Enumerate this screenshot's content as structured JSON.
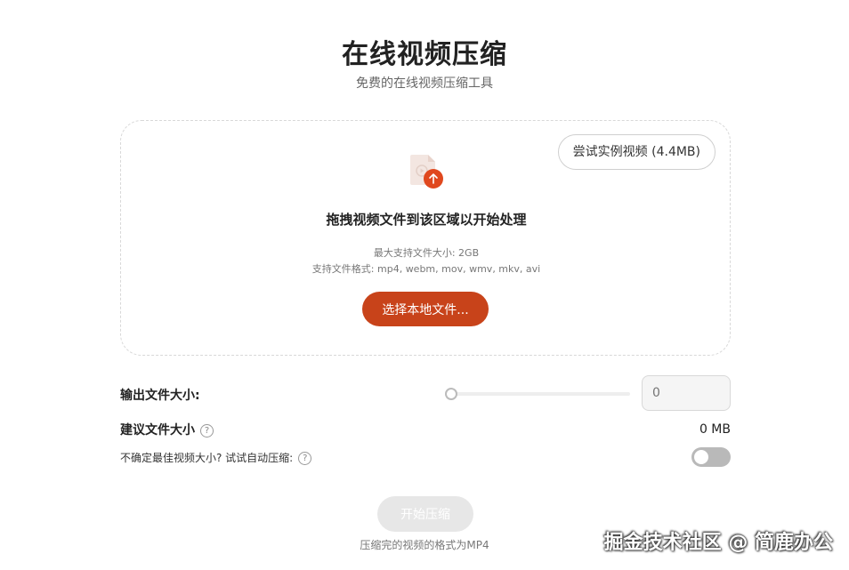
{
  "header": {
    "title": "在线视频压缩",
    "subtitle": "免费的在线视频压缩工具"
  },
  "dropzone": {
    "sample_button": "尝试实例视频 (4.4MB)",
    "icon": "video-file-upload-icon",
    "title": "拖拽视频文件到该区域以开始处理",
    "max_size": "最大支持文件大小: 2GB",
    "formats": "支持文件格式: mp4, webm, mov, wmv, mkv, avi",
    "choose_button": "选择本地文件..."
  },
  "output": {
    "label": "输出文件大小:",
    "slider_value": 0,
    "input_placeholder": "0"
  },
  "suggest": {
    "label": "建议文件大小",
    "value": "0 MB"
  },
  "auto": {
    "label": "不确定最佳视频大小? 试试自动压缩:",
    "enabled": false
  },
  "actions": {
    "start_button": "开始压缩",
    "footnote": "压缩完的视频的格式为MP4"
  },
  "watermark": "掘金技术社区 @ 简鹿办公",
  "colors": {
    "accent": "#c8431a",
    "disabled": "#e7e7e7"
  }
}
